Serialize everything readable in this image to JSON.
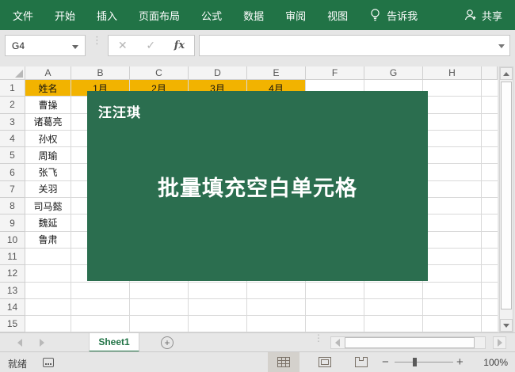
{
  "colors": {
    "ribbon_green": "#217346",
    "overlay_green": "#2b6e4f",
    "header_yellow": "#f2b300"
  },
  "ribbon": {
    "menus": [
      "文件",
      "开始",
      "插入",
      "页面布局",
      "公式",
      "数据",
      "审阅",
      "视图"
    ],
    "tell_me": "告诉我",
    "share": "共享"
  },
  "formula_bar": {
    "name_box": "G4",
    "cancel": "✕",
    "confirm": "✓",
    "fx": "fx",
    "formula": ""
  },
  "grid": {
    "columns": [
      "A",
      "B",
      "C",
      "D",
      "E",
      "F",
      "G",
      "H"
    ],
    "row_numbers": [
      "1",
      "2",
      "3",
      "4",
      "5",
      "6",
      "7",
      "8",
      "9",
      "10",
      "11",
      "12",
      "13",
      "14",
      "15"
    ],
    "header_row": [
      "姓名",
      "1月",
      "2月",
      "3月",
      "4月"
    ],
    "names": [
      "曹操",
      "诸葛亮",
      "孙权",
      "周瑜",
      "张飞",
      "关羽",
      "司马懿",
      "魏延",
      "鲁肃"
    ]
  },
  "overlay": {
    "watermark": "汪汪琪",
    "title": "批量填充空白单元格"
  },
  "sheet_tabs": {
    "active": "Sheet1",
    "add": "+"
  },
  "status_bar": {
    "ready": "就绪",
    "zoom": "100%",
    "minus": "−",
    "plus": "+"
  }
}
